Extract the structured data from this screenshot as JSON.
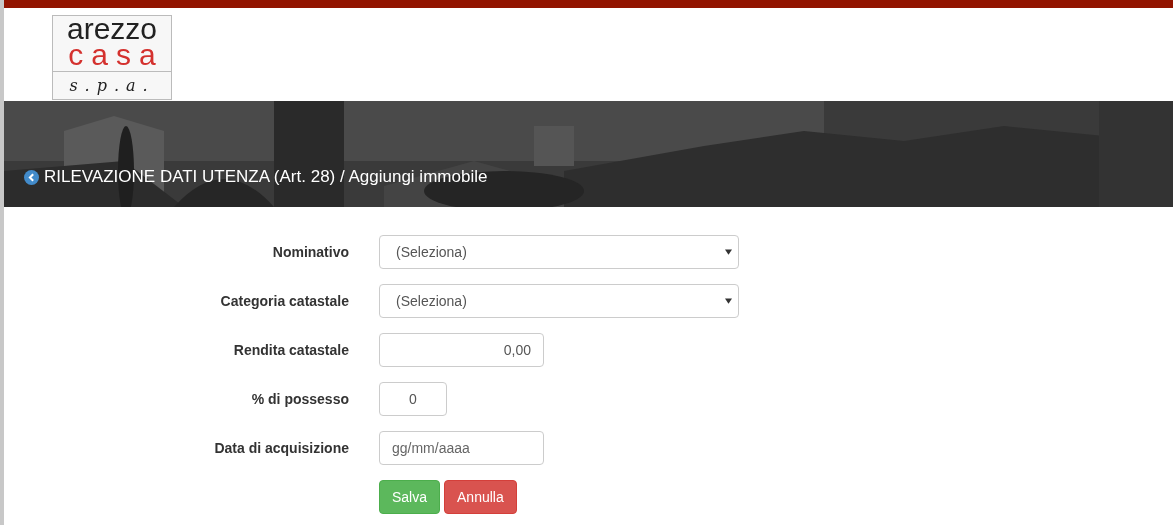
{
  "logo": {
    "line_1": "arezzo",
    "line_2": "casa",
    "line_3": "s.p.a."
  },
  "banner": {
    "kind": "picture",
    "title": "RILEVAZIONE DATI UTENZA (Art. 28) / Aggiungi immobile"
  },
  "form": {
    "fields": [
      {
        "label": "Nominativo",
        "kind": "select",
        "value": "(Seleziona)"
      },
      {
        "label": "Categoria catastale",
        "kind": "select",
        "value": "(Seleziona)"
      },
      {
        "label": "Rendita catastale",
        "kind": "number",
        "value": "0,00"
      },
      {
        "label": "% di possesso",
        "kind": "percent",
        "value": "0"
      },
      {
        "label": "Data di acquisizione",
        "kind": "date",
        "placeholder": "gg/mm/aaaa"
      }
    ],
    "buttons": [
      {
        "label": "Salva",
        "kind": "primary"
      },
      {
        "label": "Annulla",
        "kind": "danger"
      }
    ]
  }
}
